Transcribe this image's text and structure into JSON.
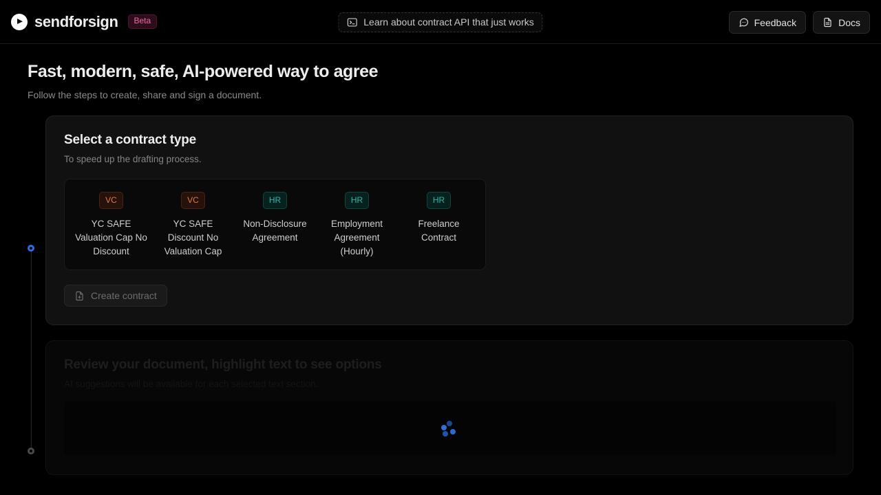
{
  "header": {
    "brand_name": "sendforsign",
    "beta_label": "Beta",
    "logo_icon": "play-circle-icon",
    "api_banner": {
      "icon": "terminal-icon",
      "label": "Learn about contract API that just works"
    },
    "actions": [
      {
        "label": "Feedback",
        "icon": "message-circle-icon"
      },
      {
        "label": "Docs",
        "icon": "file-text-icon"
      }
    ]
  },
  "page": {
    "title": "Fast, modern, safe, AI-powered way to agree",
    "subtitle": "Follow the steps to create, share and sign a document."
  },
  "steps": [
    {
      "state": "active",
      "title": "Select a contract type",
      "subtitle": "To speed up the drafting process.",
      "contract_types": [
        {
          "tag": "VC",
          "tag_kind": "vc",
          "label": "YC SAFE Valuation Cap No Discount"
        },
        {
          "tag": "VC",
          "tag_kind": "vc",
          "label": "YC SAFE Discount No Valuation Cap"
        },
        {
          "tag": "HR",
          "tag_kind": "hr",
          "label": "Non-Disclosure Agreement"
        },
        {
          "tag": "HR",
          "tag_kind": "hr",
          "label": "Employment Agreement (Hourly)"
        },
        {
          "tag": "HR",
          "tag_kind": "hr",
          "label": "Freelance Contract"
        }
      ],
      "create_button": {
        "label": "Create contract",
        "icon": "file-plus-icon",
        "disabled": true
      }
    },
    {
      "state": "pending",
      "title": "Review your document, highlight text to see options",
      "subtitle": "AI suggestions will be available for each selected text section.",
      "loading_icon": "dots-spinner-icon"
    }
  ],
  "colors": {
    "page_background": "#000000",
    "card_background": "#111111",
    "accent_blue": "#2b6ee3",
    "tag_vc": "#e07a4a",
    "tag_hr": "#2fb6ab",
    "beta_pink": "#f06aa8"
  }
}
